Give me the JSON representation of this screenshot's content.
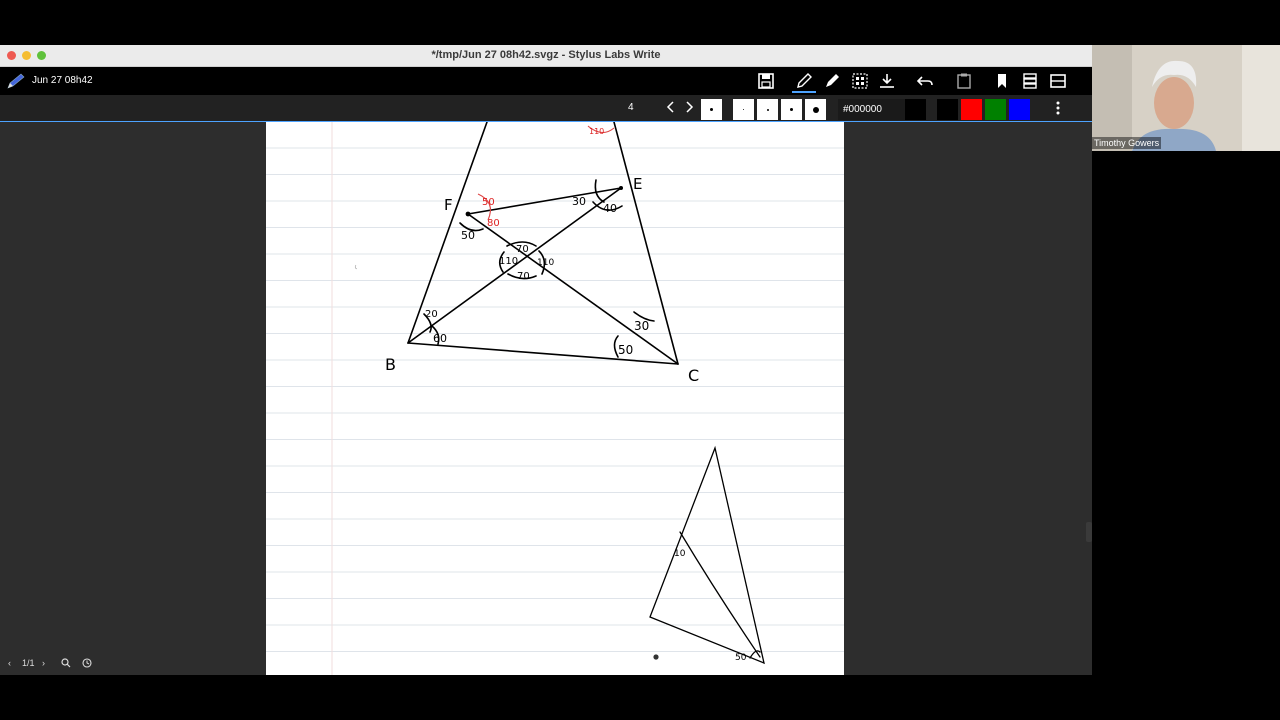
{
  "window": {
    "title": "*/tmp/Jun 27 08h42.svgz - Stylus Labs Write"
  },
  "toolbar": {
    "doc_title": "Jun 27 08h42",
    "icons": [
      "save-icon",
      "pen-icon",
      "highlighter-icon",
      "selection-icon",
      "insert-space-icon",
      "undo-icon",
      "clipboard-icon",
      "bookmark-icon",
      "pages-icon",
      "layout-icon"
    ]
  },
  "pen_toolbar": {
    "page_number": "4",
    "color_hex": "#000000",
    "colors": [
      "#000000",
      "#000000",
      "#ff0000",
      "#008000",
      "#0000ff"
    ]
  },
  "status": {
    "page_count": "1/1"
  },
  "webcam": {
    "name": "Timothy Gowers"
  },
  "drawing": {
    "labels": [
      "F",
      "E",
      "B",
      "C"
    ],
    "angles_black": [
      "50",
      "40",
      "30",
      "70",
      "110",
      "110",
      "70",
      "20",
      "60",
      "30",
      "50"
    ],
    "angles_red": [
      "50",
      "80",
      "110"
    ],
    "second_triangle_angles": [
      "10",
      "50"
    ]
  }
}
